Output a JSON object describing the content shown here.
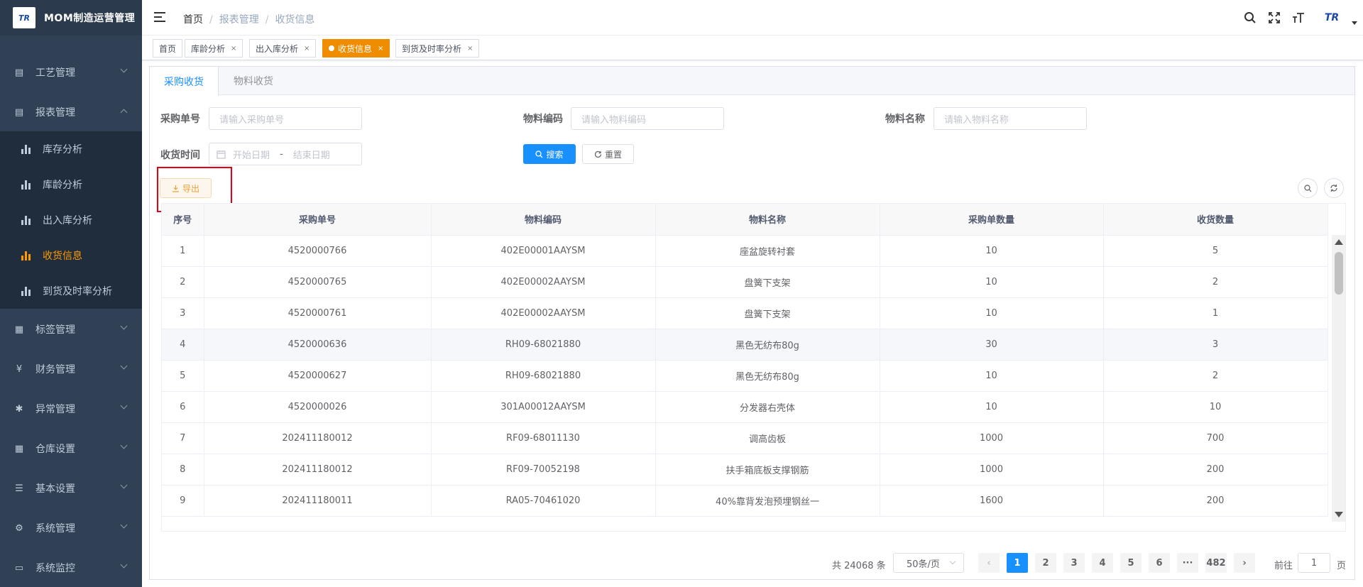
{
  "app": {
    "title": "MOM制造运营管理",
    "logo_text": "TR"
  },
  "sidebar": {
    "menus": [
      {
        "label": "工艺管理",
        "icon": "process-icon"
      },
      {
        "label": "报表管理",
        "icon": "report-icon",
        "expanded": true
      },
      {
        "label": "标签管理",
        "icon": "label-icon"
      },
      {
        "label": "财务管理",
        "icon": "yen-icon"
      },
      {
        "label": "异常管理",
        "icon": "bug-icon"
      },
      {
        "label": "仓库设置",
        "icon": "warehouse-icon"
      },
      {
        "label": "基本设置",
        "icon": "settings-icon"
      },
      {
        "label": "系统管理",
        "icon": "gear-icon"
      },
      {
        "label": "系统监控",
        "icon": "monitor-icon"
      }
    ],
    "report_submenu": [
      {
        "label": "库存分析",
        "active": false
      },
      {
        "label": "库龄分析",
        "active": false
      },
      {
        "label": "出入库分析",
        "active": false
      },
      {
        "label": "收货信息",
        "active": true
      },
      {
        "label": "到货及时率分析",
        "active": false
      }
    ]
  },
  "header": {
    "breadcrumb": [
      "首页",
      "报表管理",
      "收货信息"
    ],
    "avatar_text": "TR"
  },
  "tags": [
    {
      "label": "首页",
      "closable": false
    },
    {
      "label": "库龄分析",
      "closable": true,
      "close": "×"
    },
    {
      "label": "出入库分析",
      "closable": true,
      "close": "×"
    },
    {
      "label": "收货信息",
      "closable": true,
      "close": "×",
      "active": true
    },
    {
      "label": "到货及时率分析",
      "closable": true,
      "close": "×"
    }
  ],
  "tabs": [
    {
      "label": "采购收货",
      "active": true
    },
    {
      "label": "物料收货",
      "active": false
    }
  ],
  "filters": {
    "po_label": "采购单号",
    "po_placeholder": "请输入采购单号",
    "material_code_label": "物料编码",
    "material_code_placeholder": "请输入物料编码",
    "material_name_label": "物料名称",
    "material_name_placeholder": "请输入物料名称",
    "date_label": "收货时间",
    "start_placeholder": "开始日期",
    "range_sep": "-",
    "end_placeholder": "结束日期"
  },
  "buttons": {
    "search": "搜索",
    "reset": "重置",
    "export": "导出"
  },
  "table": {
    "columns": [
      "序号",
      "采购单号",
      "物料编码",
      "物料名称",
      "采购单数量",
      "收货数量"
    ],
    "rows": [
      [
        "1",
        "4520000766",
        "402E00001AAYSM",
        "座盆旋转衬套",
        "10",
        "5"
      ],
      [
        "2",
        "4520000765",
        "402E00002AAYSM",
        "盘簧下支架",
        "10",
        "2"
      ],
      [
        "3",
        "4520000761",
        "402E00002AAYSM",
        "盘簧下支架",
        "10",
        "1"
      ],
      [
        "4",
        "4520000636",
        "RH09-68021880",
        "黑色无纺布80g",
        "30",
        "3"
      ],
      [
        "5",
        "4520000627",
        "RH09-68021880",
        "黑色无纺布80g",
        "10",
        "2"
      ],
      [
        "6",
        "4520000026",
        "301A00012AAYSM",
        "分发器右壳体",
        "10",
        "10"
      ],
      [
        "7",
        "202411180012",
        "RF09-68011130",
        "调高齿板",
        "1000",
        "700"
      ],
      [
        "8",
        "202411180012",
        "RF09-70052198",
        "扶手箱底板支撑钢筋",
        "1000",
        "200"
      ],
      [
        "9",
        "202411180011",
        "RA05-70461020",
        "40%靠背发泡预埋钢丝一",
        "1600",
        "200"
      ]
    ]
  },
  "pagination": {
    "total_text": "共 24068 条",
    "page_size": "50条/页",
    "prev": "‹",
    "next": "›",
    "pages": [
      "1",
      "2",
      "3",
      "4",
      "5",
      "6",
      "···",
      "482"
    ],
    "current_page": "1",
    "jump_label": "前往",
    "jump_value": "1",
    "page_suffix": "页"
  },
  "colors": {
    "sidebar_bg": "#304156",
    "active_menu": "#ff9900",
    "active_tag": "#f08c00",
    "primary": "#1890ff"
  }
}
